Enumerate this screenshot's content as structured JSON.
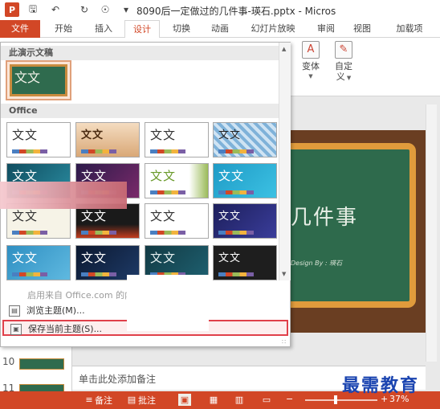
{
  "window": {
    "title": "8090后一定做过的几件事-瑛石.pptx - Micros"
  },
  "quick_access": [
    "ppt-logo-icon",
    "save-icon",
    "undo-icon",
    "redo-icon",
    "touch-mode-icon",
    "customize-qat-icon"
  ],
  "ribbon": {
    "tabs": [
      {
        "label": "文件"
      },
      {
        "label": "开始"
      },
      {
        "label": "插入"
      },
      {
        "label": "设计"
      },
      {
        "label": "切换"
      },
      {
        "label": "动画"
      },
      {
        "label": "幻灯片放映"
      },
      {
        "label": "审阅"
      },
      {
        "label": "视图"
      },
      {
        "label": "加载项"
      }
    ],
    "active_tab": "设计",
    "buttons": {
      "variant_label": "变体",
      "custom_label_1": "自定",
      "custom_label_2": "义"
    }
  },
  "gallery": {
    "section_this_doc": "此演示文稿",
    "section_office": "Office",
    "theme_sample_text": "文文",
    "online_text": "启用来自 Office.com 的内",
    "menu": {
      "browse": "浏览主题(M)...",
      "save": "保存当前主题(S)..."
    }
  },
  "thumbnails": {
    "numbers": [
      "10",
      "11"
    ]
  },
  "slide": {
    "title_fragment": "几件事",
    "subtitle_fragment": "Design By : 瑛石"
  },
  "notes": {
    "placeholder": "单击此处添加备注"
  },
  "statusbar": {
    "notes_label": "备注",
    "comments_label": "批注",
    "zoom": "37%"
  },
  "watermark": "最需教育",
  "colors": {
    "accent": "#d24726",
    "highlight_border": "#e0404a"
  }
}
